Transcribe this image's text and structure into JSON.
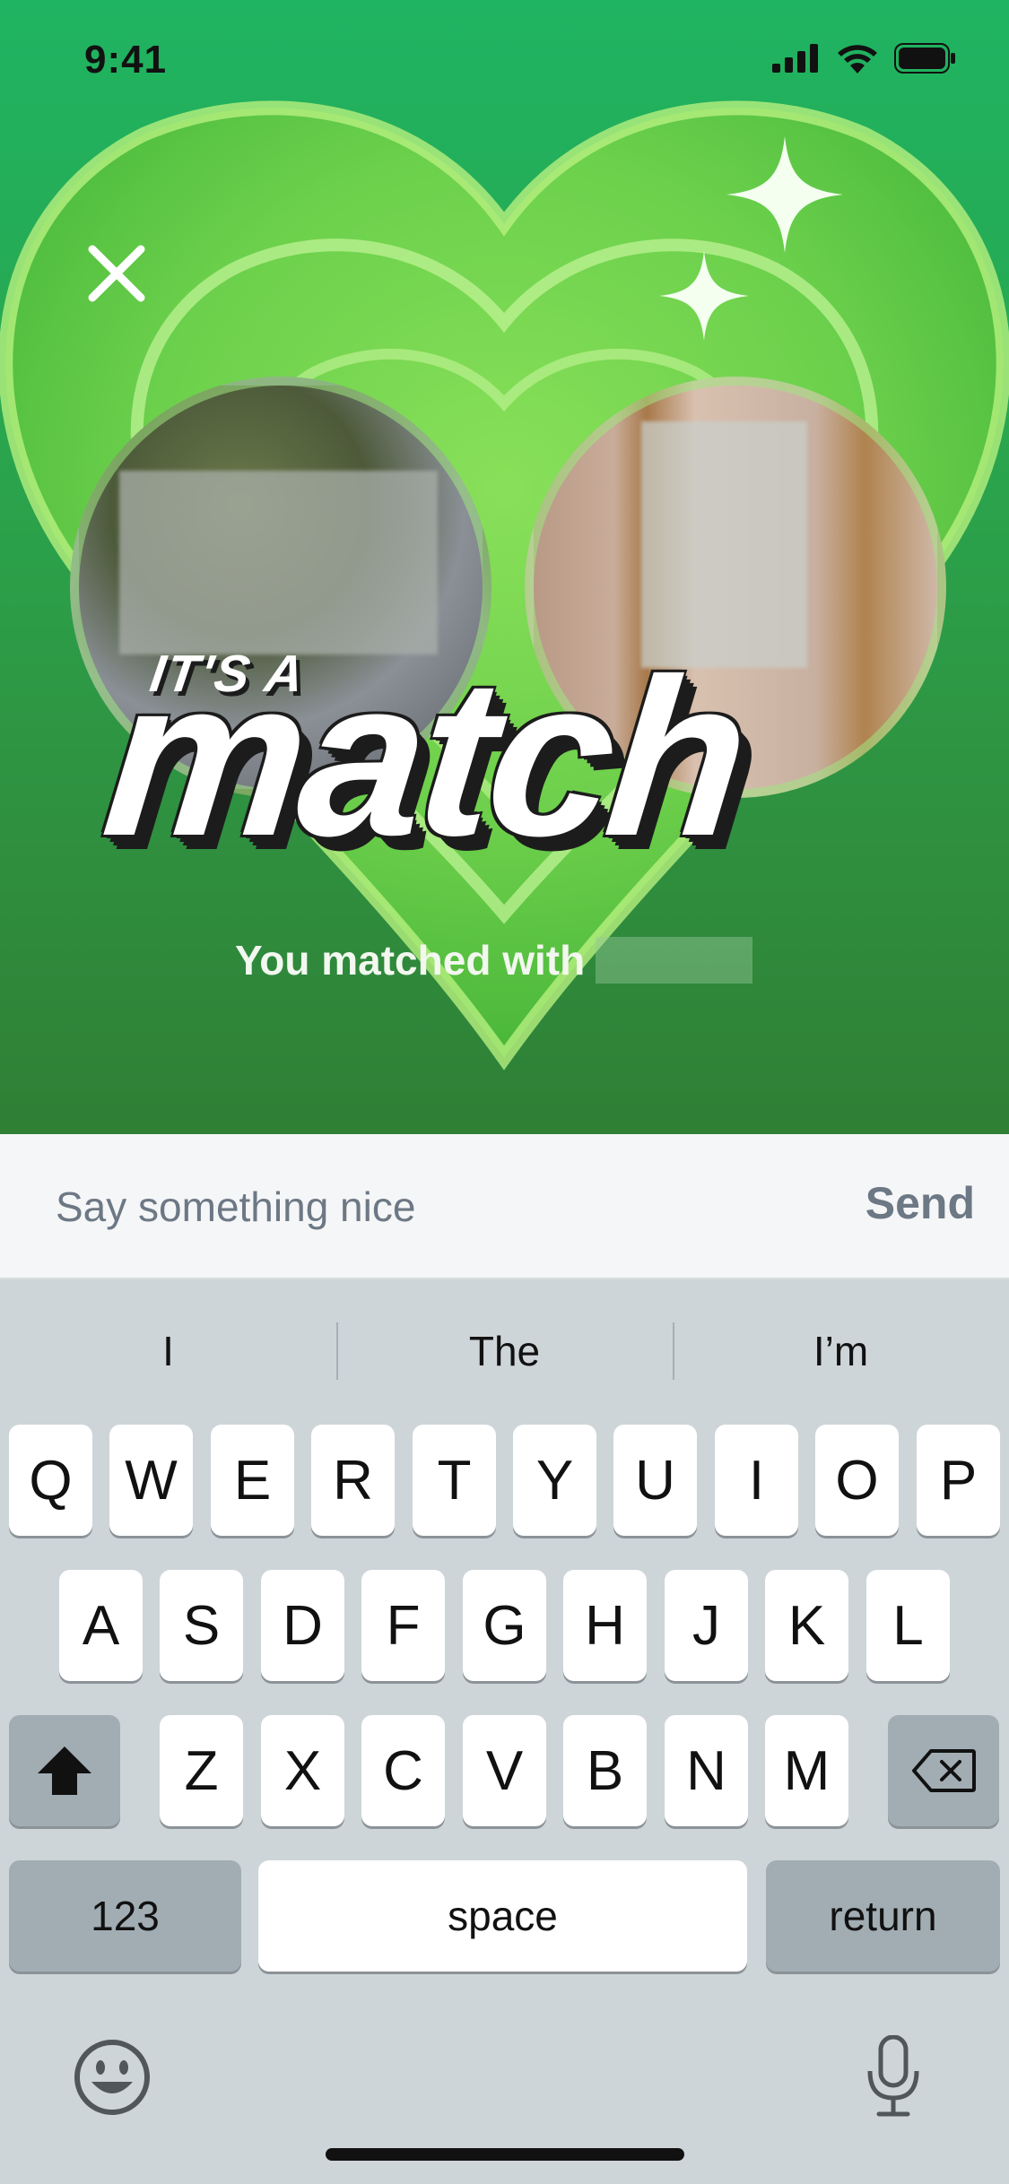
{
  "status_bar": {
    "time": "9:41"
  },
  "match": {
    "headline_small": "IT'S A",
    "headline_big": "match",
    "matched_text": "You matched with"
  },
  "message": {
    "placeholder": "Say something nice",
    "send_label": "Send"
  },
  "keyboard": {
    "suggestions": [
      "I",
      "The",
      "I’m"
    ],
    "row1": [
      "Q",
      "W",
      "E",
      "R",
      "T",
      "Y",
      "U",
      "I",
      "O",
      "P"
    ],
    "row2": [
      "A",
      "S",
      "D",
      "F",
      "G",
      "H",
      "J",
      "K",
      "L"
    ],
    "row3": [
      "Z",
      "X",
      "C",
      "V",
      "B",
      "N",
      "M"
    ],
    "numbers_label": "123",
    "space_label": "space",
    "return_label": "return"
  },
  "colors": {
    "accent_green": "#1fb462",
    "send_gray": "#6d7885"
  }
}
